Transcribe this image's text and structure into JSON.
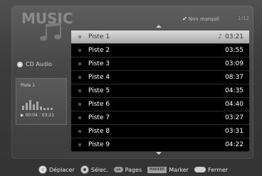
{
  "header": {
    "title": "MUSIC",
    "marked_legend": "Non marqué",
    "page_counter": "1/12"
  },
  "sidebar": {
    "source_label": "CD Audio",
    "now_playing": {
      "track": "Piste  1",
      "elapsed": "00:04",
      "total": "03:21"
    }
  },
  "tracks": [
    {
      "name": "Piste 1",
      "duration": "03:21",
      "selected": true
    },
    {
      "name": "Piste 2",
      "duration": "03:55"
    },
    {
      "name": "Piste 3",
      "duration": "03:09"
    },
    {
      "name": "Piste 4",
      "duration": "08:37"
    },
    {
      "name": "Piste 5",
      "duration": "04:35"
    },
    {
      "name": "Piste 6",
      "duration": "04:40"
    },
    {
      "name": "Piste 7",
      "duration": "03:27"
    },
    {
      "name": "Piste 8",
      "duration": "03:31"
    },
    {
      "name": "Piste 9",
      "duration": "04:22"
    }
  ],
  "footer": {
    "move": "Déplacer",
    "select": "Sélec.",
    "pages": "Pages",
    "marker_key": "MARKER",
    "marker": "Marker",
    "close": "Fermer"
  },
  "colors": {
    "selected_row": "#c8c8c8",
    "list_bg": "#000000"
  }
}
